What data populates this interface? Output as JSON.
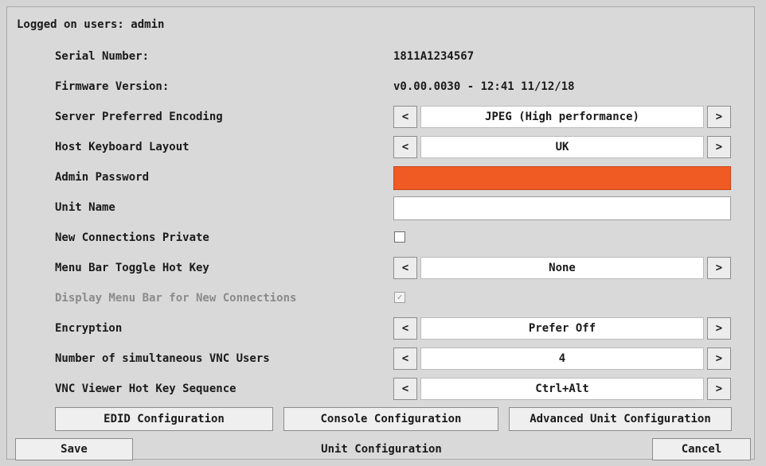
{
  "header": {
    "logged_on": "Logged on users: admin"
  },
  "rows": {
    "serial": {
      "label": "Serial Number:",
      "value": "1811A1234567"
    },
    "firmware": {
      "label": "Firmware Version:",
      "value": "v0.00.0030 - 12:41 11/12/18"
    },
    "encoding": {
      "label": "Server Preferred Encoding",
      "value": "JPEG (High performance)"
    },
    "keyboard": {
      "label": "Host Keyboard Layout",
      "value": "UK"
    },
    "admin_password": {
      "label": "Admin Password",
      "value": ""
    },
    "unit_name": {
      "label": "Unit Name",
      "value": ""
    },
    "new_conn_private": {
      "label": "New Connections Private",
      "checked": false
    },
    "menu_hotkey": {
      "label": "Menu Bar Toggle Hot Key",
      "value": "None"
    },
    "display_menu": {
      "label": "Display Menu Bar for New Connections",
      "checked": true,
      "disabled": true,
      "check_glyph": "✓"
    },
    "encryption": {
      "label": "Encryption",
      "value": "Prefer Off"
    },
    "vnc_users": {
      "label": "Number of simultaneous VNC Users",
      "value": "4"
    },
    "vnc_hotkey": {
      "label": "VNC Viewer Hot Key Sequence",
      "value": "Ctrl+Alt"
    }
  },
  "spinner": {
    "prev": "<",
    "next": ">"
  },
  "buttons": {
    "edid": "EDID Configuration",
    "console": "Console Configuration",
    "advanced": "Advanced Unit Configuration"
  },
  "footer": {
    "save": "Save",
    "title": "Unit Configuration",
    "cancel": "Cancel"
  },
  "colors": {
    "alert_field": "#f05a23",
    "background": "#d9d9d9"
  }
}
